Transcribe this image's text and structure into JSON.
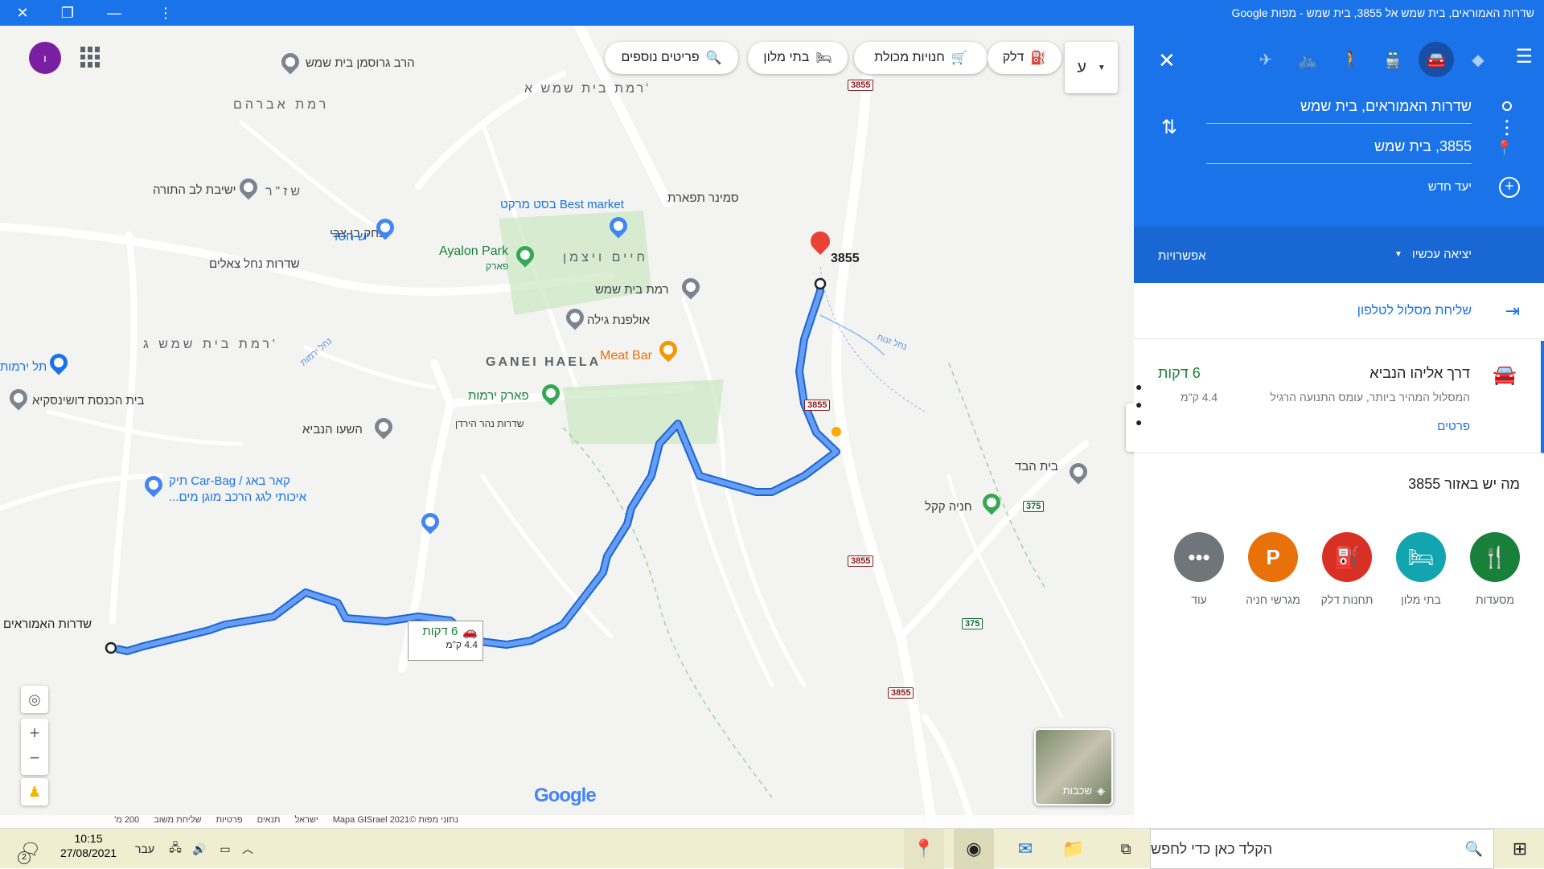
{
  "window": {
    "title": "שדרות האמוראים, בית שמש אל 3855, בית שמש - מפות Google"
  },
  "map": {
    "chips": [
      "פריטים נוספים",
      "בתי מלון",
      "חנויות מכולת",
      "דלק"
    ],
    "lang_button": "ע",
    "origin_label": "שדרות האמוראים",
    "dest_label": "3855",
    "route_box": {
      "time": "6 דקות",
      "distance": "4.4 ק\"מ"
    },
    "neighborhood": "GANEI HAELA",
    "places": {
      "best_market": "Best market בסט מרקט",
      "ayalon_park": "Ayalon Park",
      "ayalon_park_sub": "פארק",
      "seminar": "סמינר תפארת",
      "ramat_bs": "רמת בית שמש",
      "ulpana": "אולפנת גילה",
      "meat_bar": "Meat Bar",
      "park_yarmut": "פארק ירמות",
      "hashaa": "השעו הנביא",
      "car_bag_1": "קאר באג / Car-Bag תיק",
      "car_bag_2": "איכותי לגג הרכב מוגן מים...",
      "yesh_chesed": "יש חסד",
      "yeshiva": "ישיבת לב התורה",
      "rav_grossman": "הרב גרוסמן בית שמש",
      "tel_yarmut": "תל ירמות",
      "beit_knesset": "בית הכנסת דושינסקיא",
      "beit_hamad": "בית הבד",
      "chanaya": "חניה קקל"
    },
    "streets": {
      "ramat_a": "רמת בית שמש א'",
      "ramat_g": "רמת בית שמש ג'",
      "avraham": "רמת אברהם",
      "shaz": "שז\"ר",
      "yitzhak": "יצחק בן צבי",
      "haim": "חיים ויצמן",
      "nahal_tzalim": "שדרות נחל צאלים",
      "nahar_hayarden": "שדרות נהר הירדן",
      "nahal_yarmut": "נחל ירמות",
      "nahal_zanoach": "נחל זנוח"
    },
    "road_shields": [
      "3855",
      "3855",
      "3855",
      "3855",
      "375",
      "375"
    ],
    "layers_label": "שכבות",
    "footer": [
      "נתוני מפות ©2021 Mapa GISrael",
      "ישראל",
      "תנאים",
      "פרטיות",
      "שליחת משוב",
      "200 מ'"
    ],
    "google_logo": "Google"
  },
  "panel": {
    "origin": "שדרות האמוראים, בית שמש",
    "destination": "3855, בית שמש",
    "add_destination": "יעד חדש",
    "depart": "יציאה עכשיו",
    "options": "אפשרויות",
    "send_to_phone": "שליחת מסלול לטלפון",
    "route": {
      "name": "דרך אליהו הנביא",
      "time": "6 דקות",
      "desc": "המסלול המהיר ביותר, עומס התנועה הרגיל",
      "distance": "4.4 ק\"מ",
      "details": "פרטים"
    },
    "nearby_title": "מה יש באזור 3855",
    "categories": [
      {
        "label": "מסעדות",
        "color": "#188038",
        "icon": "restaurant-icon"
      },
      {
        "label": "בתי מלון",
        "color": "#12a4af",
        "icon": "hotel-icon"
      },
      {
        "label": "תחנות דלק",
        "color": "#d93025",
        "icon": "gas-icon"
      },
      {
        "label": "מגרשי חניה",
        "color": "#e8710a",
        "icon": "parking-icon"
      },
      {
        "label": "עוד",
        "color": "#70757a",
        "icon": "more-icon"
      }
    ]
  },
  "taskbar": {
    "search_placeholder": "הקלד כאן כדי לחפש",
    "time": "10:15",
    "date": "27/08/2021",
    "lang": "עבר",
    "notif_count": "2"
  },
  "colors": {
    "accent": "#1a73e8",
    "route": "#4285f4"
  }
}
